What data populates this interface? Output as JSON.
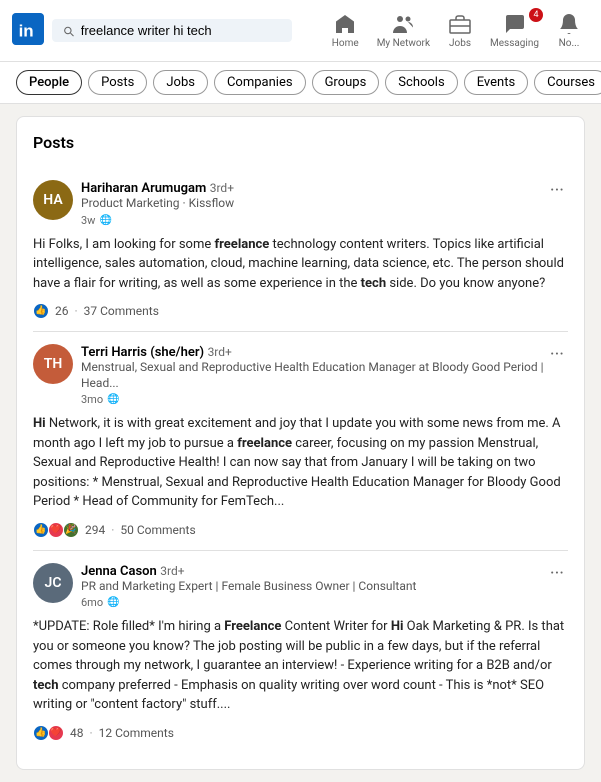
{
  "nav": {
    "search_placeholder": "freelance writer hi tech",
    "icons": [
      {
        "id": "home",
        "label": "Home",
        "badge": null
      },
      {
        "id": "my_network",
        "label": "My Network",
        "badge": null
      },
      {
        "id": "jobs",
        "label": "Jobs",
        "badge": null
      },
      {
        "id": "messaging",
        "label": "Messaging",
        "badge": "4"
      },
      {
        "id": "notifications",
        "label": "No...",
        "badge": null
      }
    ]
  },
  "filters": {
    "chips": [
      {
        "id": "people",
        "label": "People",
        "active": false
      },
      {
        "id": "posts",
        "label": "Posts",
        "active": false
      },
      {
        "id": "jobs",
        "label": "Jobs",
        "active": false
      },
      {
        "id": "companies",
        "label": "Companies",
        "active": false
      },
      {
        "id": "groups",
        "label": "Groups",
        "active": false
      },
      {
        "id": "schools",
        "label": "Schools",
        "active": false
      },
      {
        "id": "events",
        "label": "Events",
        "active": false
      },
      {
        "id": "courses",
        "label": "Courses",
        "active": false
      }
    ]
  },
  "posts_section": {
    "title": "Posts",
    "posts": [
      {
        "id": "post1",
        "author": "Hariharan Arumugam",
        "degree": "3rd+",
        "title": "Product Marketing · Kissflow",
        "time": "3w",
        "avatar_initials": "HA",
        "avatar_class": "avatar-ha",
        "text_html": "Hi Folks, I am looking for some <strong>freelance</strong> technology content writers. Topics like artificial intelligence, sales automation, cloud, machine learning, data science, etc. The person should have a flair for writing, as well as some experience in the <strong>tech</strong> side. Do you know anyone?",
        "reactions": [
          "👍"
        ],
        "reaction_count": "26",
        "comments_count": "37 Comments"
      },
      {
        "id": "post2",
        "author": "Terri Harris (she/her)",
        "degree": "3rd+",
        "title": "Menstrual, Sexual and Reproductive Health Education Manager at Bloody Good Period | Head...",
        "time": "3mo",
        "avatar_initials": "TH",
        "avatar_class": "avatar-th",
        "text_html": "<strong>Hi</strong> Network, it is with great excitement and joy that I update you with some news from me. A month ago I left my job to pursue a <strong>freelance</strong> career, focusing on my passion Menstrual, Sexual and Reproductive Health! I can now say that from January I will be taking on two positions: * Menstrual, Sexual and Reproductive Health Education Manager for Bloody Good Period * Head of Community for FemTech...",
        "reactions": [
          "👍",
          "❤️",
          "🎉"
        ],
        "reaction_count": "294",
        "comments_count": "50 Comments"
      },
      {
        "id": "post3",
        "author": "Jenna Cason",
        "degree": "3rd+",
        "title": "PR and Marketing Expert | Female Business Owner | Consultant",
        "time": "6mo",
        "avatar_initials": "JC",
        "avatar_class": "avatar-jc",
        "text_html": "*UPDATE: Role filled* I'm hiring a <strong>Freelance</strong> Content Writer for <strong>Hi</strong> Oak Marketing & PR. Is that you or someone you know? The job posting will be public in a few days, but if the referral comes through my network, I guarantee an interview! - Experience writing for a B2B and/or <strong>tech</strong> company preferred - Emphasis on quality writing over word count - This is *not* SEO writing or \"content factory\" stuff....",
        "reactions": [
          "👍",
          "❤️"
        ],
        "reaction_count": "48",
        "comments_count": "12 Comments"
      }
    ]
  }
}
